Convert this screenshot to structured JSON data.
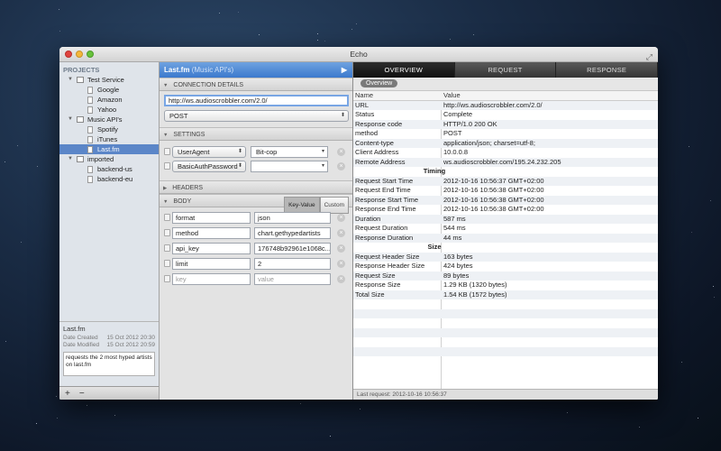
{
  "window": {
    "title": "Echo"
  },
  "sidebar": {
    "projects_label": "PROJECTS",
    "tree": [
      {
        "label": "Test Service",
        "type": "project",
        "level": 0,
        "expanded": true
      },
      {
        "label": "Google",
        "type": "request",
        "level": 1
      },
      {
        "label": "Amazon",
        "type": "request",
        "level": 1
      },
      {
        "label": "Yahoo",
        "type": "request",
        "level": 1
      },
      {
        "label": "Music API's",
        "type": "project",
        "level": 0,
        "expanded": true
      },
      {
        "label": "Spotify",
        "type": "request",
        "level": 1
      },
      {
        "label": "iTunes",
        "type": "request",
        "level": 1
      },
      {
        "label": "Last.fm",
        "type": "request",
        "level": 1,
        "selected": true
      },
      {
        "label": "imported",
        "type": "project",
        "level": 0,
        "expanded": true
      },
      {
        "label": "backend-us",
        "type": "request",
        "level": 1
      },
      {
        "label": "backend-eu",
        "type": "request",
        "level": 1
      }
    ],
    "info": {
      "title": "Last.fm",
      "date_created_label": "Date Created",
      "date_created": "15 Oct 2012 20:30",
      "date_modified_label": "Date Modified",
      "date_modified": "15 Oct 2012 20:59",
      "notes": "requests the 2 most hyped artists on last.fm"
    },
    "footer": {
      "add": "+",
      "remove": "−"
    }
  },
  "request": {
    "title": "Last.fm",
    "subtitle": "(Music API's)",
    "connection_label": "CONNECTION DETAILS",
    "url": "http://ws.audioscrobbler.com/2.0/",
    "method": "POST",
    "settings_label": "SETTINGS",
    "settings": [
      {
        "name": "UserAgent",
        "value": "Bit-cop"
      },
      {
        "name": "BasicAuthPassword",
        "value": ""
      }
    ],
    "headers_label": "HEADERS",
    "body_label": "BODY",
    "body_mode_kv": "Key-Value",
    "body_mode_custom": "Custom",
    "body": [
      {
        "key": "format",
        "value": "json"
      },
      {
        "key": "method",
        "value": "chart.gethypedartists"
      },
      {
        "key": "api_key",
        "value": "176748b92961e1068c..."
      },
      {
        "key": "limit",
        "value": "2"
      }
    ],
    "body_placeholder_key": "key",
    "body_placeholder_value": "value"
  },
  "response": {
    "tabs": [
      "OVERVIEW",
      "REQUEST",
      "RESPONSE"
    ],
    "active_tab": "OVERVIEW",
    "subtab": "Overview",
    "col_name": "Name",
    "col_value": "Value",
    "rows": [
      {
        "name": "URL",
        "value": "http://ws.audioscrobbler.com/2.0/"
      },
      {
        "name": "Status",
        "value": "Complete"
      },
      {
        "name": "Response code",
        "value": "HTTP/1.0 200 OK"
      },
      {
        "name": "method",
        "value": "POST"
      },
      {
        "name": "Content-type",
        "value": "application/json; charset=utf-8;"
      },
      {
        "name": "Client Address",
        "value": "10.0.0.8"
      },
      {
        "name": "Remote Address",
        "value": "ws.audioscrobbler.com/195.24.232.205"
      },
      {
        "group": "Timing"
      },
      {
        "name": "Request Start Time",
        "value": "2012-10-16 10:56:37 GMT+02:00"
      },
      {
        "name": "Request End Time",
        "value": "2012-10-16 10:56:38 GMT+02:00"
      },
      {
        "name": "Response Start Time",
        "value": "2012-10-16 10:56:38 GMT+02:00"
      },
      {
        "name": "Response End Time",
        "value": "2012-10-16 10:56:38 GMT+02:00"
      },
      {
        "name": "Duration",
        "value": "587 ms"
      },
      {
        "name": "Request Duration",
        "value": "544 ms"
      },
      {
        "name": "Response Duration",
        "value": "44 ms"
      },
      {
        "group": "Size"
      },
      {
        "name": "Request Header Size",
        "value": "163 bytes"
      },
      {
        "name": "Response Header Size",
        "value": "424 bytes"
      },
      {
        "name": "Request Size",
        "value": "89 bytes"
      },
      {
        "name": "Response Size",
        "value": "1.29 KB (1320 bytes)"
      },
      {
        "name": "Total Size",
        "value": "1.54 KB (1572 bytes)"
      }
    ],
    "status": "Last request: 2012-10-16 10:56:37"
  }
}
